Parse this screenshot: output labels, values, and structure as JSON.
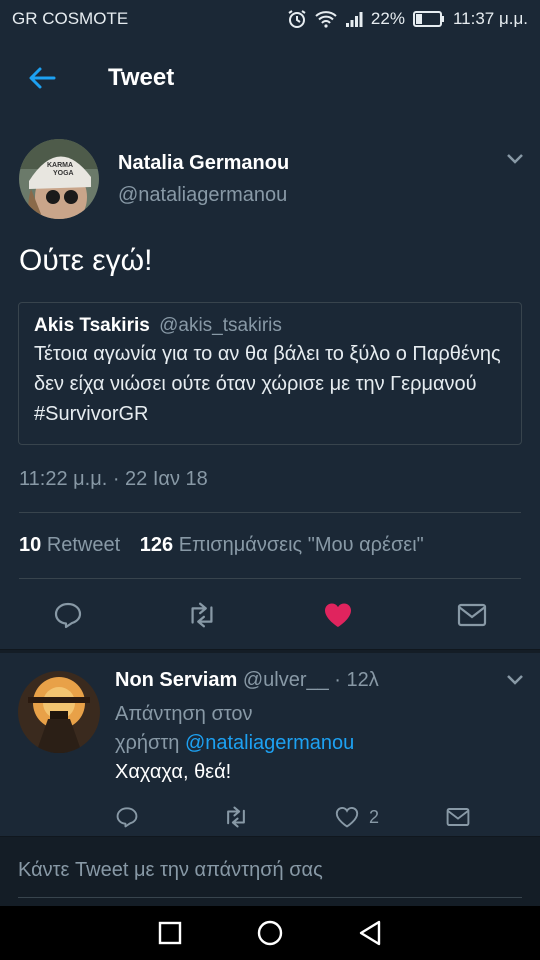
{
  "status_bar": {
    "carrier": "GR COSMOTE",
    "battery_percent": "22%",
    "time": "11:37 μ.μ.",
    "icons": [
      "alarm-icon",
      "wifi-icon",
      "signal-icon",
      "battery-icon"
    ]
  },
  "app_bar": {
    "title": "Tweet",
    "back_icon": "arrow-left-icon"
  },
  "tweet": {
    "author_name": "Natalia Germanou",
    "author_handle": "@nataliagermanou",
    "text": "Ούτε εγώ!",
    "quote": {
      "author_name": "Akis Tsakiris",
      "author_handle": "@akis_tsakiris",
      "text": "Τέτοια αγωνία για το αν θα βάλει το ξύλο ο Παρθένης δεν είχα νιώσει ούτε όταν χώρισε με την Γερμανού #SurvivorGR"
    },
    "timestamp": "11:22 μ.μ. · 22 Ιαν 18",
    "retweet_count": "10",
    "retweet_label": "Retweet",
    "like_count": "126",
    "like_label": "Επισημάνσεις \"Μου αρέσει\"",
    "liked": true
  },
  "reply": {
    "author_name": "Non Serviam",
    "author_handle": "@ulver__",
    "time_ago": "· 12λ",
    "reply_to_line1": "Απάντηση στον",
    "reply_to_line2": "χρήστη",
    "reply_to_mention": "@nataliagermanou",
    "text": "Χαχαχα, θεά!",
    "like_count": "2"
  },
  "compose": {
    "placeholder": "Κάντε Tweet με την απάντησή σας"
  },
  "colors": {
    "background": "#141d26",
    "card": "#1b2836",
    "accent": "#1da1f2",
    "like": "#e0245e",
    "muted": "#8899a6"
  }
}
